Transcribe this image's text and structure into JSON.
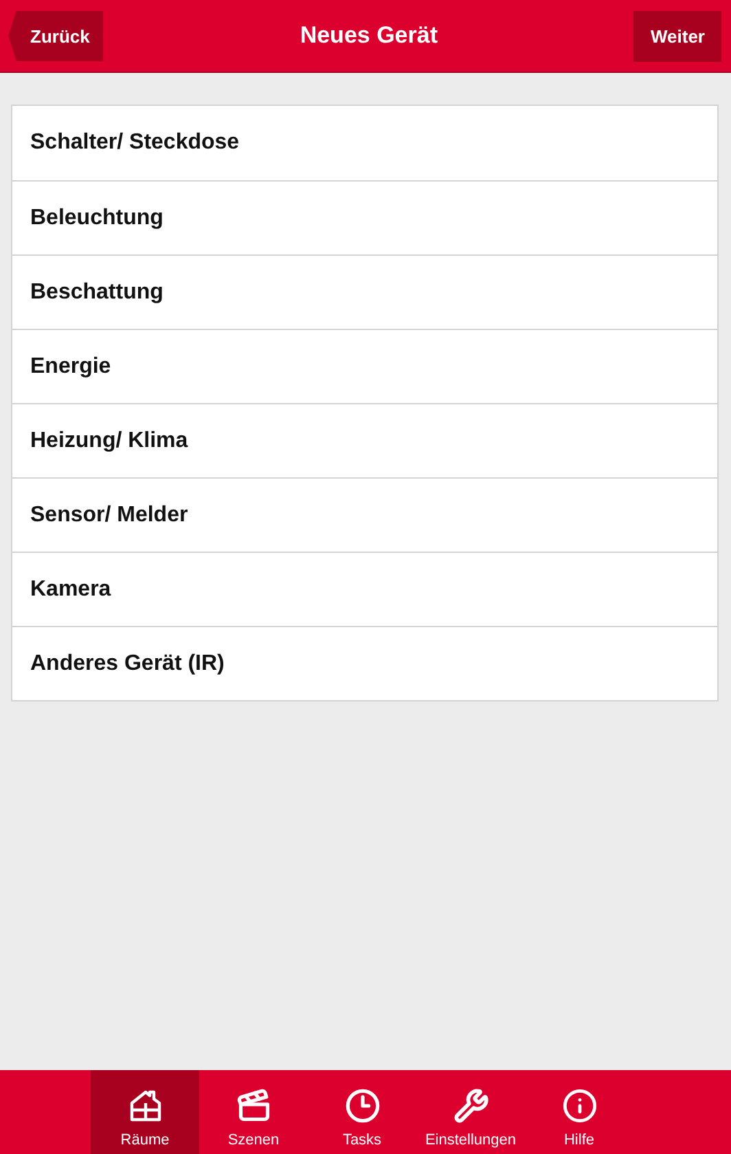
{
  "header": {
    "back": "Zurück",
    "title": "Neues Gerät",
    "next": "Weiter"
  },
  "device_types": [
    {
      "label": "Schalter/ Steckdose"
    },
    {
      "label": "Beleuchtung"
    },
    {
      "label": "Beschattung"
    },
    {
      "label": "Energie"
    },
    {
      "label": "Heizung/ Klima"
    },
    {
      "label": "Sensor/ Melder"
    },
    {
      "label": "Kamera"
    },
    {
      "label": "Anderes Gerät (IR)"
    }
  ],
  "tab_bar": [
    {
      "label": "Räume",
      "kind": "rooms",
      "selected": true
    },
    {
      "label": "Szenen",
      "kind": "scenes",
      "selected": false
    },
    {
      "label": "Tasks",
      "kind": "tasks",
      "selected": false
    },
    {
      "label": "Einstellungen",
      "kind": "settings",
      "selected": false
    },
    {
      "label": "Hilfe",
      "kind": "help",
      "selected": false
    }
  ]
}
